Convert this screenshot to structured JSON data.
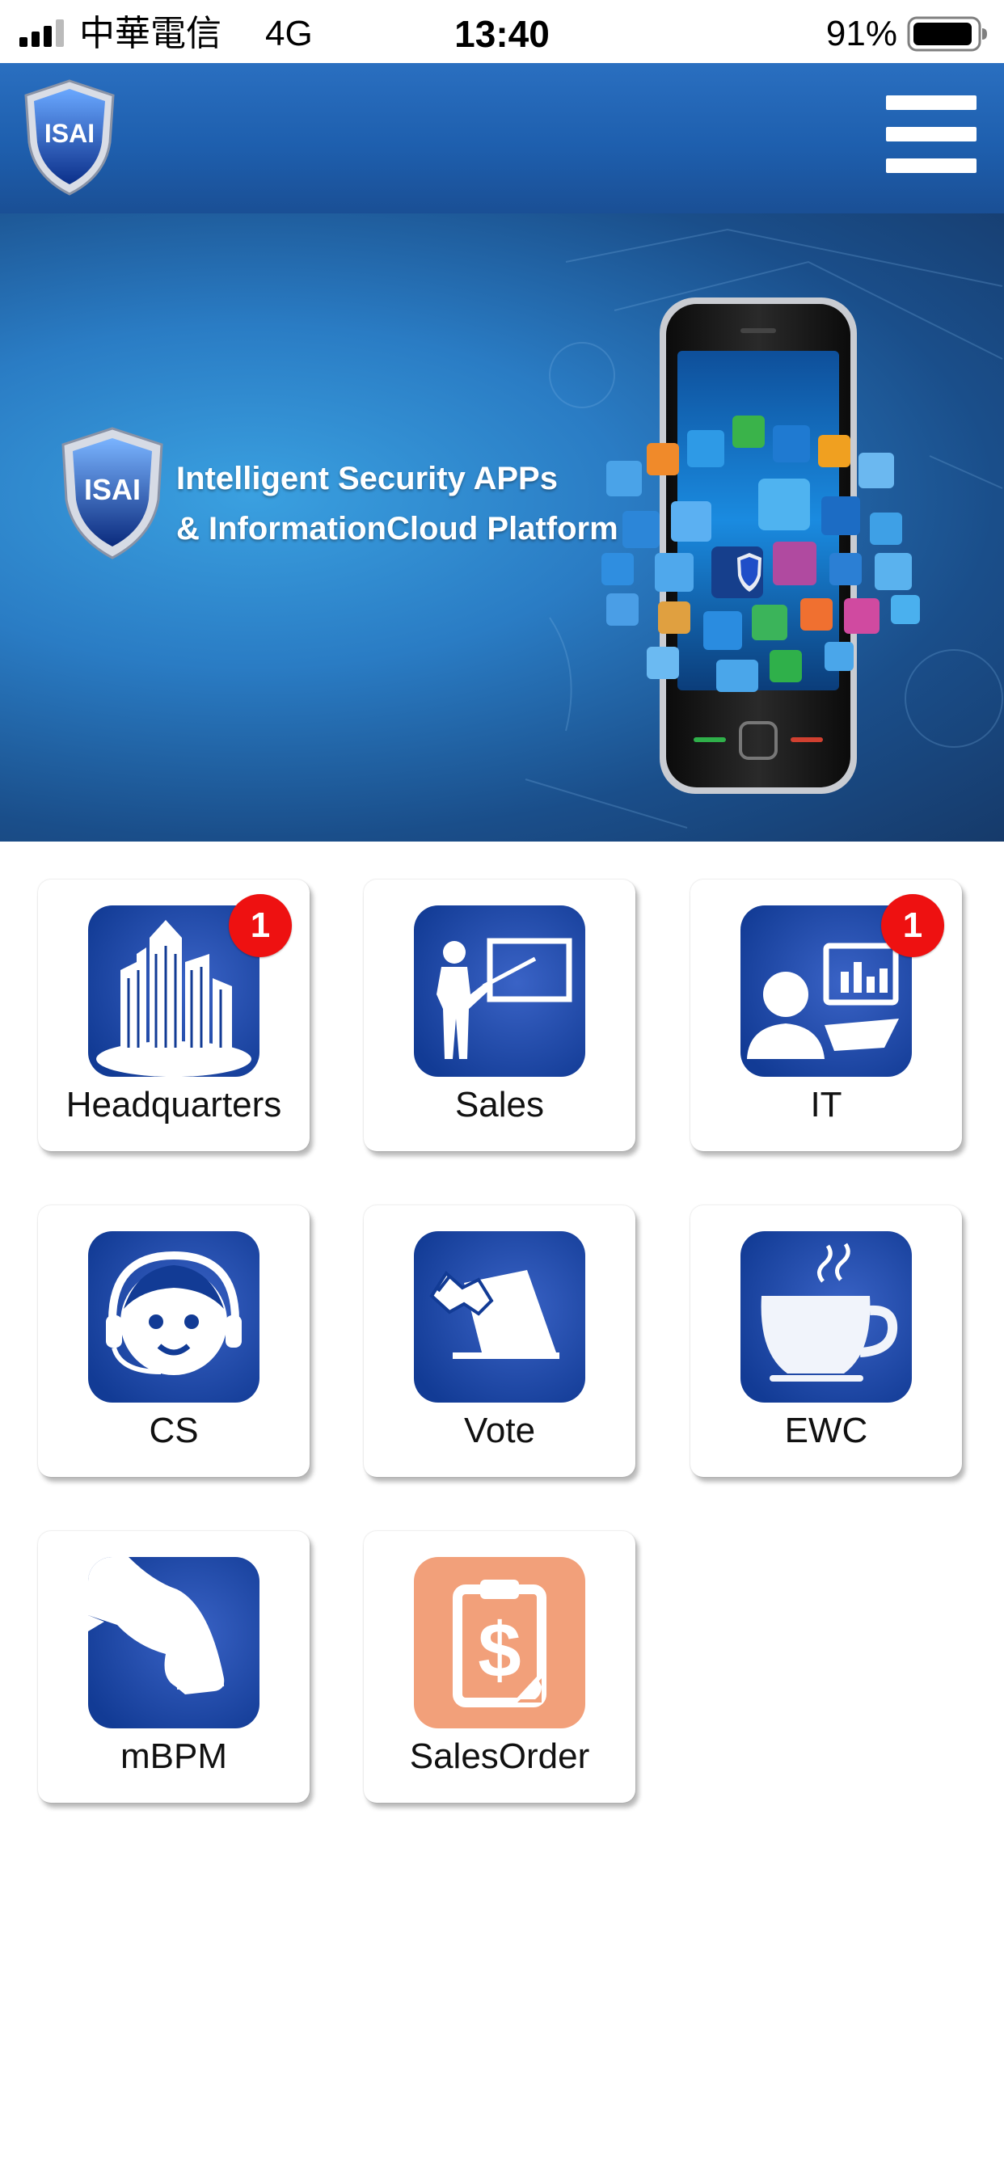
{
  "status_bar": {
    "carrier": "中華電信",
    "network": "4G",
    "time": "13:40",
    "battery": "91%"
  },
  "header": {
    "logo_text": "ISAI",
    "menu_icon": "hamburger-menu-icon",
    "color": "#1e5fae"
  },
  "banner": {
    "logo_text": "ISAI",
    "line1": "Intelligent Security APPs",
    "line2": "& InformationCloud Platform"
  },
  "tiles": [
    {
      "label": "Headquarters",
      "icon": "buildings-icon",
      "badge": "1"
    },
    {
      "label": "Sales",
      "icon": "presentation-icon",
      "badge": ""
    },
    {
      "label": "IT",
      "icon": "computer-user-icon",
      "badge": "1"
    },
    {
      "label": "CS",
      "icon": "headset-agent-icon",
      "badge": ""
    },
    {
      "label": "Vote",
      "icon": "ballot-box-icon",
      "badge": ""
    },
    {
      "label": "EWC",
      "icon": "coffee-cup-icon",
      "badge": ""
    },
    {
      "label": "mBPM",
      "icon": "pen-hand-icon",
      "badge": ""
    },
    {
      "label": "SalesOrder",
      "icon": "dollar-clipboard-icon",
      "badge": ""
    }
  ],
  "colors": {
    "icon_blue": "#123b95",
    "sales_order_orange": "#f2a07a",
    "badge_red": "#ee1111"
  }
}
